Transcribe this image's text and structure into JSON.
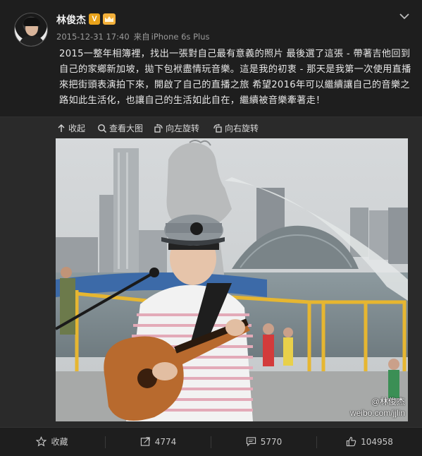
{
  "post": {
    "username": "林俊杰",
    "vbadge": "V",
    "timestamp": "2015-12-31 17:40",
    "source_prefix": "来自",
    "source": "iPhone 6s Plus",
    "text": "2015一整年相簿裡，找出一張對自己最有意義的照片 最後選了這張 - 帶著吉他回到自己的家鄉新加坡，拋下包袱盡情玩音樂。這是我的初衷 - 那天是我第一次使用直播來把街頭表演拍下來，開啟了自己的直播之旅 希望2016年可以繼續讓自己的音樂之路如此生活化，也讓自己的生活如此自在，繼續被音樂牽著走！"
  },
  "media_actions": {
    "collapse": "收起",
    "view_large": "查看大图",
    "rotate_left": "向左旋转",
    "rotate_right": "向右旋转"
  },
  "photo": {
    "watermark_line1": "@林俊杰",
    "watermark_line2": "weibo.com/jjlin"
  },
  "footer": {
    "favorite": "收藏",
    "repost_count": "4774",
    "comment_count": "5770",
    "like_count": "104958"
  },
  "colors": {
    "background": "#1e1e1e",
    "badge_orange": "#e8a21a"
  }
}
